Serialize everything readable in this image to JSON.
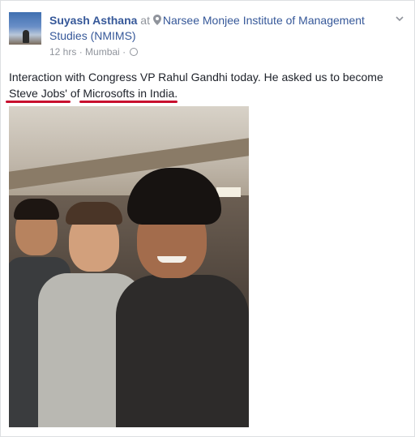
{
  "post": {
    "author": "Suyash Asthana",
    "at_word": "at",
    "place": "Narsee Monjee Institute of Management Studies (NMIMS)",
    "time": "12 hrs",
    "separator": "·",
    "location": "Mumbai",
    "separator2": "·",
    "text_part1": "Interaction with Congress VP Rahul Gandhi today. He asked us to become ",
    "text_underlined1": "Steve Jobs'",
    "text_part2": " of ",
    "text_underlined2": "Microsofts in India",
    "text_part3": "."
  },
  "icons": {
    "location_pin": "map-pin-icon",
    "privacy": "globe-icon",
    "options": "chevron-down-icon"
  },
  "colors": {
    "link": "#365899",
    "meta": "#90949c",
    "underline": "#c8102e"
  }
}
